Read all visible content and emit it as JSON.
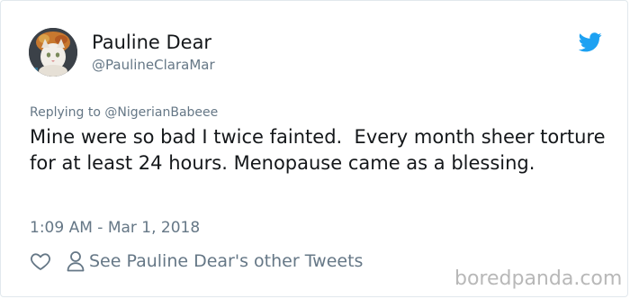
{
  "user": {
    "display_name": "Pauline Dear",
    "handle": "@PaulineClaraMar",
    "avatar_icon": "cat-avatar"
  },
  "brand": {
    "icon": "twitter-bird-icon",
    "color": "#1da1f2"
  },
  "tweet": {
    "replying_to": "Replying to @NigerianBabeee",
    "text": "Mine were so bad I twice fainted.  Every month sheer torture for at least 24 hours. Menopause came as a blessing.",
    "timestamp": "1:09 AM - Mar 1, 2018"
  },
  "actions": {
    "like_icon": "heart-icon",
    "profile_icon": "person-icon",
    "other_tweets_label": "See Pauline Dear's other Tweets"
  },
  "watermark": {
    "text": "boredpanda.com"
  },
  "colors": {
    "primary_text": "#14171a",
    "secondary_text": "#657786",
    "border": "#e1e8ed",
    "watermark": "#b8b8b8"
  }
}
